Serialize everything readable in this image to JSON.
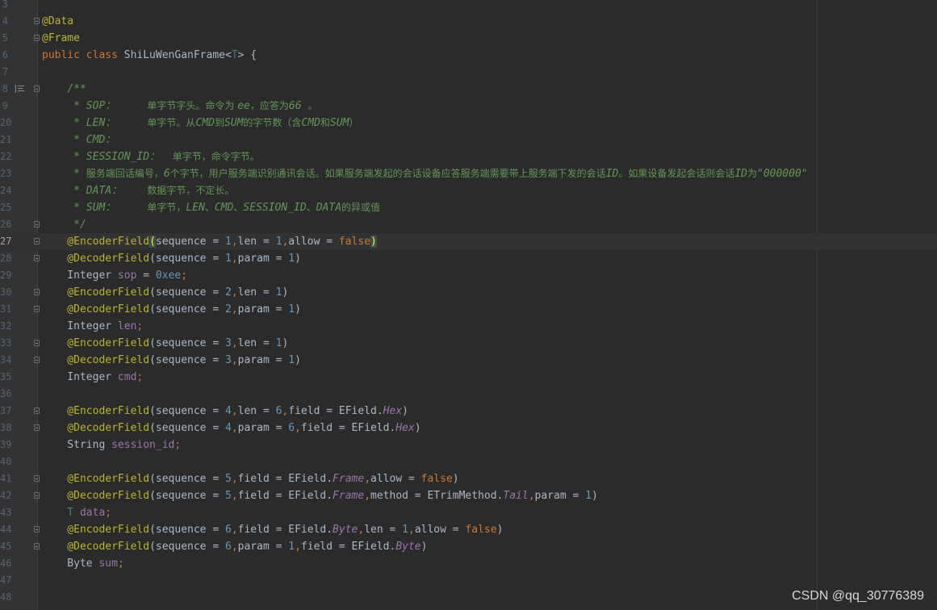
{
  "editor": {
    "lines": [
      {
        "num": "3",
        "tokens": []
      },
      {
        "num": "4",
        "fold": true,
        "tokens": [
          {
            "t": "@Data",
            "c": "t-ann"
          }
        ]
      },
      {
        "num": "5",
        "fold": true,
        "tokens": [
          {
            "t": "@Frame",
            "c": "t-ann"
          }
        ]
      },
      {
        "num": "6",
        "tokens": [
          {
            "t": "public class ",
            "c": "t-kw"
          },
          {
            "t": "ShiLuWenGanFrame<",
            "c": "t-cls"
          },
          {
            "t": "T",
            "c": "t-gen"
          },
          {
            "t": "> {",
            "c": "t-plain"
          }
        ]
      },
      {
        "num": "7",
        "tokens": []
      },
      {
        "num": "8",
        "fold": true,
        "doc_icon": true,
        "tokens": [
          {
            "t": "    /**",
            "c": "t-doc"
          }
        ]
      },
      {
        "num": "9",
        "tokens": [
          {
            "t": "     * SOP：     ",
            "c": "t-doc"
          },
          {
            "t": "单字节字头。命令为 ",
            "c": "t-doc-cjk"
          },
          {
            "t": "ee",
            "c": "t-doc"
          },
          {
            "t": "，应答为",
            "c": "t-doc-cjk"
          },
          {
            "t": "66 ",
            "c": "t-doc"
          },
          {
            "t": "。",
            "c": "t-doc-cjk"
          }
        ]
      },
      {
        "num": "20",
        "tokens": [
          {
            "t": "     * LEN：     ",
            "c": "t-doc"
          },
          {
            "t": "单字节。从",
            "c": "t-doc-cjk"
          },
          {
            "t": "CMD",
            "c": "t-doc"
          },
          {
            "t": "到",
            "c": "t-doc-cjk"
          },
          {
            "t": "SUM",
            "c": "t-doc"
          },
          {
            "t": "的字节数（含",
            "c": "t-doc-cjk"
          },
          {
            "t": "CMD",
            "c": "t-doc"
          },
          {
            "t": "和",
            "c": "t-doc-cjk"
          },
          {
            "t": "SUM",
            "c": "t-doc"
          },
          {
            "t": "）",
            "c": "t-doc-cjk"
          }
        ]
      },
      {
        "num": "21",
        "tokens": [
          {
            "t": "     * CMD：",
            "c": "t-doc"
          }
        ]
      },
      {
        "num": "22",
        "tokens": [
          {
            "t": "     * SESSION_ID：  ",
            "c": "t-doc"
          },
          {
            "t": "单字节，命令字节。",
            "c": "t-doc-cjk"
          }
        ]
      },
      {
        "num": "23",
        "tokens": [
          {
            "t": "     * ",
            "c": "t-doc"
          },
          {
            "t": "服务端回话编号，",
            "c": "t-doc-cjk"
          },
          {
            "t": "6",
            "c": "t-doc"
          },
          {
            "t": "个字节，用户服务端识别通讯会话。如果服务端发起的会话设备应答服务端需要带上服务端下发的会话",
            "c": "t-doc-cjk"
          },
          {
            "t": "ID",
            "c": "t-doc"
          },
          {
            "t": "。如果设备发起会话则会话",
            "c": "t-doc-cjk"
          },
          {
            "t": "ID",
            "c": "t-doc"
          },
          {
            "t": "为",
            "c": "t-doc-cjk"
          },
          {
            "t": "\"000000\"",
            "c": "t-doc"
          }
        ]
      },
      {
        "num": "24",
        "tokens": [
          {
            "t": "     * DATA：    ",
            "c": "t-doc"
          },
          {
            "t": "数据字节，不定长。",
            "c": "t-doc-cjk"
          }
        ]
      },
      {
        "num": "25",
        "tokens": [
          {
            "t": "     * SUM：     ",
            "c": "t-doc"
          },
          {
            "t": "单字节，",
            "c": "t-doc-cjk"
          },
          {
            "t": "LEN",
            "c": "t-doc"
          },
          {
            "t": "、",
            "c": "t-doc-cjk"
          },
          {
            "t": "CMD",
            "c": "t-doc"
          },
          {
            "t": "、",
            "c": "t-doc-cjk"
          },
          {
            "t": "SESSION_ID",
            "c": "t-doc"
          },
          {
            "t": "、",
            "c": "t-doc-cjk"
          },
          {
            "t": "DATA",
            "c": "t-doc"
          },
          {
            "t": "的异或值",
            "c": "t-doc-cjk"
          }
        ]
      },
      {
        "num": "26",
        "fold": true,
        "tokens": [
          {
            "t": "     */",
            "c": "t-doc"
          }
        ]
      },
      {
        "num": "27",
        "fold": true,
        "current": true,
        "tokens": [
          {
            "t": "    @EncoderField",
            "c": "t-ann"
          },
          {
            "t": "(",
            "c": "t-brace-hl"
          },
          {
            "t": "sequence = ",
            "c": "t-plain"
          },
          {
            "t": "1",
            "c": "t-num"
          },
          {
            "t": ",",
            "c": "t-kw"
          },
          {
            "t": "len = ",
            "c": "t-plain"
          },
          {
            "t": "1",
            "c": "t-num"
          },
          {
            "t": ",",
            "c": "t-kw"
          },
          {
            "t": "allow = ",
            "c": "t-plain"
          },
          {
            "t": "false",
            "c": "t-kw"
          },
          {
            "t": ")",
            "c": "t-brace-hl"
          }
        ]
      },
      {
        "num": "28",
        "fold": true,
        "tokens": [
          {
            "t": "    @DecoderField",
            "c": "t-ann"
          },
          {
            "t": "(sequence = ",
            "c": "t-plain"
          },
          {
            "t": "1",
            "c": "t-num"
          },
          {
            "t": ",",
            "c": "t-kw"
          },
          {
            "t": "param = ",
            "c": "t-plain"
          },
          {
            "t": "1",
            "c": "t-num"
          },
          {
            "t": ")",
            "c": "t-plain"
          }
        ]
      },
      {
        "num": "29",
        "tokens": [
          {
            "t": "    Integer ",
            "c": "t-plain"
          },
          {
            "t": "sop",
            "c": "t-fld"
          },
          {
            "t": " = ",
            "c": "t-plain"
          },
          {
            "t": "0xee",
            "c": "t-num"
          },
          {
            "t": ";",
            "c": "t-kw"
          }
        ]
      },
      {
        "num": "30",
        "fold": true,
        "tokens": [
          {
            "t": "    @EncoderField",
            "c": "t-ann"
          },
          {
            "t": "(sequence = ",
            "c": "t-plain"
          },
          {
            "t": "2",
            "c": "t-num"
          },
          {
            "t": ",",
            "c": "t-kw"
          },
          {
            "t": "len = ",
            "c": "t-plain"
          },
          {
            "t": "1",
            "c": "t-num"
          },
          {
            "t": ")",
            "c": "t-plain"
          }
        ]
      },
      {
        "num": "31",
        "fold": true,
        "tokens": [
          {
            "t": "    @DecoderField",
            "c": "t-ann"
          },
          {
            "t": "(sequence = ",
            "c": "t-plain"
          },
          {
            "t": "2",
            "c": "t-num"
          },
          {
            "t": ",",
            "c": "t-kw"
          },
          {
            "t": "param = ",
            "c": "t-plain"
          },
          {
            "t": "1",
            "c": "t-num"
          },
          {
            "t": ")",
            "c": "t-plain"
          }
        ]
      },
      {
        "num": "32",
        "tokens": [
          {
            "t": "    Integer ",
            "c": "t-plain"
          },
          {
            "t": "len",
            "c": "t-fld"
          },
          {
            "t": ";",
            "c": "t-kw"
          }
        ]
      },
      {
        "num": "33",
        "fold": true,
        "tokens": [
          {
            "t": "    @EncoderField",
            "c": "t-ann"
          },
          {
            "t": "(sequence = ",
            "c": "t-plain"
          },
          {
            "t": "3",
            "c": "t-num"
          },
          {
            "t": ",",
            "c": "t-kw"
          },
          {
            "t": "len = ",
            "c": "t-plain"
          },
          {
            "t": "1",
            "c": "t-num"
          },
          {
            "t": ")",
            "c": "t-plain"
          }
        ]
      },
      {
        "num": "34",
        "fold": true,
        "tokens": [
          {
            "t": "    @DecoderField",
            "c": "t-ann"
          },
          {
            "t": "(sequence = ",
            "c": "t-plain"
          },
          {
            "t": "3",
            "c": "t-num"
          },
          {
            "t": ",",
            "c": "t-kw"
          },
          {
            "t": "param = ",
            "c": "t-plain"
          },
          {
            "t": "1",
            "c": "t-num"
          },
          {
            "t": ")",
            "c": "t-plain"
          }
        ]
      },
      {
        "num": "35",
        "tokens": [
          {
            "t": "    Integer ",
            "c": "t-plain"
          },
          {
            "t": "cmd",
            "c": "t-fld"
          },
          {
            "t": ";",
            "c": "t-kw"
          }
        ]
      },
      {
        "num": "36",
        "tokens": []
      },
      {
        "num": "37",
        "fold": true,
        "tokens": [
          {
            "t": "    @EncoderField",
            "c": "t-ann"
          },
          {
            "t": "(sequence = ",
            "c": "t-plain"
          },
          {
            "t": "4",
            "c": "t-num"
          },
          {
            "t": ",",
            "c": "t-kw"
          },
          {
            "t": "len = ",
            "c": "t-plain"
          },
          {
            "t": "6",
            "c": "t-num"
          },
          {
            "t": ",",
            "c": "t-kw"
          },
          {
            "t": "field = EField.",
            "c": "t-plain"
          },
          {
            "t": "Hex",
            "c": "t-fld-i"
          },
          {
            "t": ")",
            "c": "t-plain"
          }
        ]
      },
      {
        "num": "38",
        "fold": true,
        "tokens": [
          {
            "t": "    @DecoderField",
            "c": "t-ann"
          },
          {
            "t": "(sequence = ",
            "c": "t-plain"
          },
          {
            "t": "4",
            "c": "t-num"
          },
          {
            "t": ",",
            "c": "t-kw"
          },
          {
            "t": "param = ",
            "c": "t-plain"
          },
          {
            "t": "6",
            "c": "t-num"
          },
          {
            "t": ",",
            "c": "t-kw"
          },
          {
            "t": "field = EField.",
            "c": "t-plain"
          },
          {
            "t": "Hex",
            "c": "t-fld-i"
          },
          {
            "t": ")",
            "c": "t-plain"
          }
        ]
      },
      {
        "num": "39",
        "tokens": [
          {
            "t": "    String ",
            "c": "t-plain"
          },
          {
            "t": "session_id",
            "c": "t-fld"
          },
          {
            "t": ";",
            "c": "t-kw"
          }
        ]
      },
      {
        "num": "40",
        "tokens": []
      },
      {
        "num": "41",
        "fold": true,
        "tokens": [
          {
            "t": "    @EncoderField",
            "c": "t-ann"
          },
          {
            "t": "(sequence = ",
            "c": "t-plain"
          },
          {
            "t": "5",
            "c": "t-num"
          },
          {
            "t": ",",
            "c": "t-kw"
          },
          {
            "t": "field = EField.",
            "c": "t-plain"
          },
          {
            "t": "Frame",
            "c": "t-fld-i"
          },
          {
            "t": ",",
            "c": "t-kw"
          },
          {
            "t": "allow = ",
            "c": "t-plain"
          },
          {
            "t": "false",
            "c": "t-kw"
          },
          {
            "t": ")",
            "c": "t-plain"
          }
        ]
      },
      {
        "num": "42",
        "fold": true,
        "tokens": [
          {
            "t": "    @DecoderField",
            "c": "t-ann"
          },
          {
            "t": "(sequence = ",
            "c": "t-plain"
          },
          {
            "t": "5",
            "c": "t-num"
          },
          {
            "t": ",",
            "c": "t-kw"
          },
          {
            "t": "field = EField.",
            "c": "t-plain"
          },
          {
            "t": "Frame",
            "c": "t-fld-i"
          },
          {
            "t": ",",
            "c": "t-kw"
          },
          {
            "t": "method = ETrimMethod.",
            "c": "t-plain"
          },
          {
            "t": "Tail",
            "c": "t-fld-i"
          },
          {
            "t": ",",
            "c": "t-kw"
          },
          {
            "t": "param = ",
            "c": "t-plain"
          },
          {
            "t": "1",
            "c": "t-num"
          },
          {
            "t": ")",
            "c": "t-plain"
          }
        ]
      },
      {
        "num": "43",
        "tokens": [
          {
            "t": "    T ",
            "c": "t-gen"
          },
          {
            "t": "data",
            "c": "t-fld"
          },
          {
            "t": ";",
            "c": "t-kw"
          }
        ]
      },
      {
        "num": "44",
        "fold": true,
        "tokens": [
          {
            "t": "    @EncoderField",
            "c": "t-ann"
          },
          {
            "t": "(sequence = ",
            "c": "t-plain"
          },
          {
            "t": "6",
            "c": "t-num"
          },
          {
            "t": ",",
            "c": "t-kw"
          },
          {
            "t": "field = EField.",
            "c": "t-plain"
          },
          {
            "t": "Byte",
            "c": "t-fld-i"
          },
          {
            "t": ",",
            "c": "t-kw"
          },
          {
            "t": "len = ",
            "c": "t-plain"
          },
          {
            "t": "1",
            "c": "t-num"
          },
          {
            "t": ",",
            "c": "t-kw"
          },
          {
            "t": "allow = ",
            "c": "t-plain"
          },
          {
            "t": "false",
            "c": "t-kw"
          },
          {
            "t": ")",
            "c": "t-plain"
          }
        ]
      },
      {
        "num": "45",
        "fold": true,
        "tokens": [
          {
            "t": "    @DecoderField",
            "c": "t-ann"
          },
          {
            "t": "(sequence = ",
            "c": "t-plain"
          },
          {
            "t": "6",
            "c": "t-num"
          },
          {
            "t": ",",
            "c": "t-kw"
          },
          {
            "t": "param = ",
            "c": "t-plain"
          },
          {
            "t": "1",
            "c": "t-num"
          },
          {
            "t": ",",
            "c": "t-kw"
          },
          {
            "t": "field = EField.",
            "c": "t-plain"
          },
          {
            "t": "Byte",
            "c": "t-fld-i"
          },
          {
            "t": ")",
            "c": "t-plain"
          }
        ]
      },
      {
        "num": "46",
        "tokens": [
          {
            "t": "    Byte ",
            "c": "t-plain"
          },
          {
            "t": "sum",
            "c": "t-fld"
          },
          {
            "t": ";",
            "c": "t-kw"
          }
        ]
      },
      {
        "num": "47",
        "tokens": []
      },
      {
        "num": "48",
        "tokens": []
      }
    ]
  },
  "watermark": "CSDN @qq_30776389"
}
